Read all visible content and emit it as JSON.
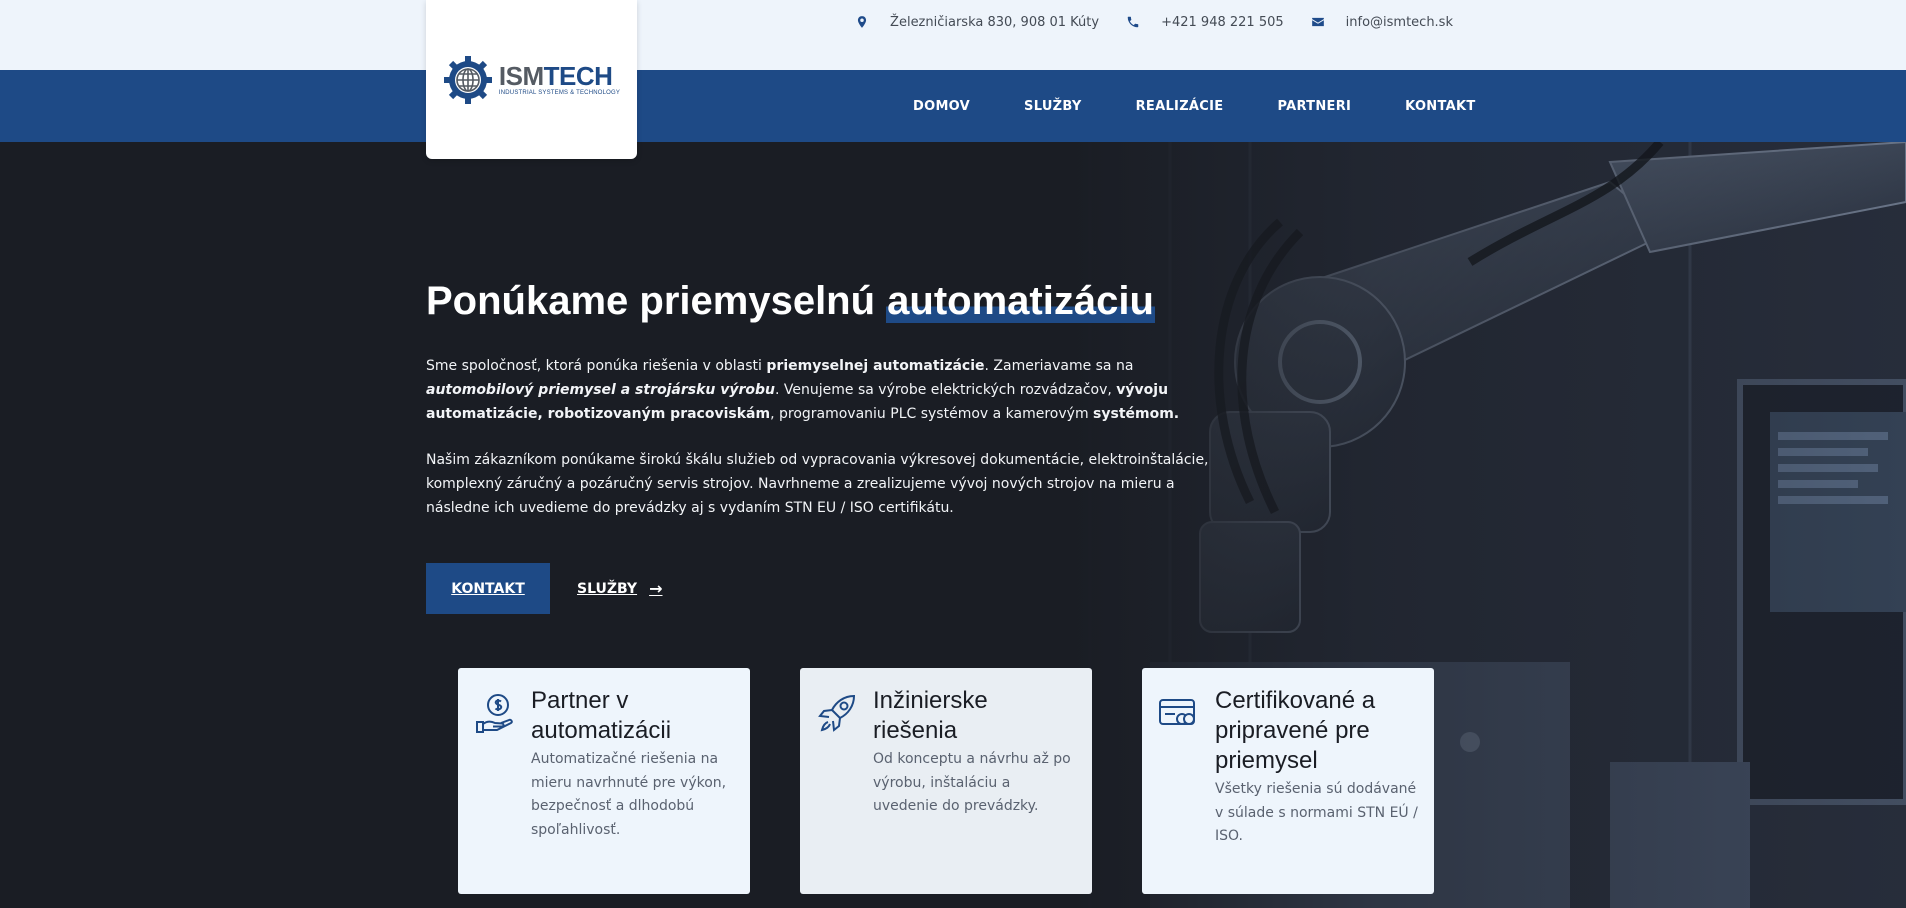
{
  "topbar": {
    "address": "Železničiarska 830, 908 01 Kúty",
    "phone": "+421 948 221 505",
    "email": "info@ismtech.sk"
  },
  "logo": {
    "word_a": "ISM",
    "word_b": "TECH",
    "tagline": "INDUSTRIAL SYSTEMS & TECHNOLOGY"
  },
  "nav": {
    "items": [
      "DOMOV",
      "SLUŽBY",
      "REALIZÁCIE",
      "PARTNERI",
      "KONTAKT"
    ]
  },
  "hero": {
    "title_plain": "Ponúkame priemyselnú ",
    "title_highlight": "automatizáciu",
    "p1_parts": [
      "Sme spoločnosť, ktorá ponúka riešenia v oblasti ",
      "priemyselnej automatizácie",
      ". Zameriavame sa na ",
      "automobilový priemysel a strojársku výrobu",
      ". Venujeme sa výrobe elektrických rozvádzačov, ",
      "vývoju automatizácie, robotizovaným pracoviskám",
      ", programovaniu PLC systémov a kamerovým ",
      "systémom."
    ],
    "p2": "Našim zákazníkom ponúkame širokú škálu služieb od vypracovania výkresovej dokumentácie, elektroinštalácie, komplexný záručný a pozáručný servis strojov. Navrhneme a zrealizujeme vývoj nových strojov na mieru a následne ich uvedieme do prevádzky aj s vydaním STN EU / ISO certifikátu.",
    "primary_button": "KONTAKT",
    "secondary_button": "SLUŽBY",
    "secondary_arrow": "→"
  },
  "cards": [
    {
      "icon": "money-hand-icon",
      "title": "Partner v automatizácii",
      "text": "Automatizačné riešenia na mieru navrhnuté pre výkon, bezpečnosť a dlhodobú spoľahlivosť."
    },
    {
      "icon": "rocket-icon",
      "title": "Inžinierske riešenia",
      "text": "Od konceptu a návrhu až po výrobu, inštaláciu a uvedenie do prevádzky."
    },
    {
      "icon": "certificate-card-icon",
      "title": "Certifikované a pripravené pre priemysel",
      "text": "Všetky riešenia sú dodávané v súlade s normami STN EÚ / ISO."
    }
  ],
  "colors": {
    "brand_blue": "#1e4a86",
    "topbar_bg": "#eef4fb",
    "hero_bg": "#1a1d24"
  }
}
